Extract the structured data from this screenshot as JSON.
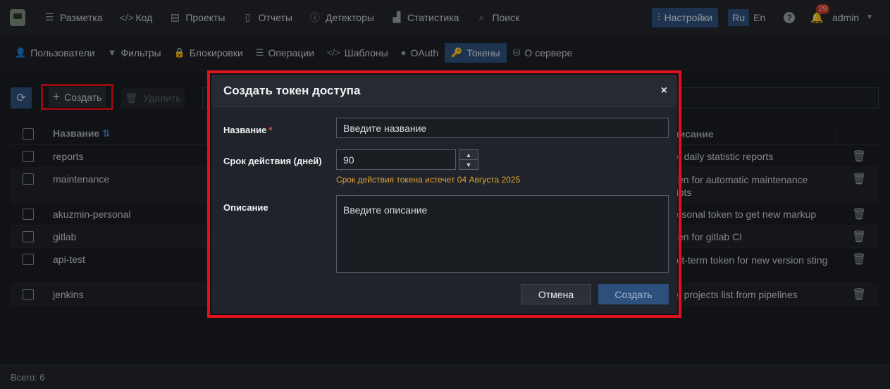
{
  "topnav": {
    "items": [
      {
        "label": "Разметка",
        "icon": "list-icon"
      },
      {
        "label": "Код",
        "icon": "code-icon"
      },
      {
        "label": "Проекты",
        "icon": "box-icon"
      },
      {
        "label": "Отчеты",
        "icon": "document-icon"
      },
      {
        "label": "Детекторы",
        "icon": "alert-circle-icon"
      },
      {
        "label": "Статистика",
        "icon": "chart-icon"
      },
      {
        "label": "Поиск",
        "icon": "search-icon"
      }
    ],
    "settings_label": "Настройки",
    "lang_ru": "Ru",
    "lang_en": "En",
    "notifications_count": "29",
    "user": "admin"
  },
  "subnav": {
    "items": [
      {
        "label": "Пользователи",
        "icon": "users-icon"
      },
      {
        "label": "Фильтры",
        "icon": "filter-icon"
      },
      {
        "label": "Блокировки",
        "icon": "lock-icon"
      },
      {
        "label": "Операции",
        "icon": "list-icon"
      },
      {
        "label": "Шаблоны",
        "icon": "code-icon"
      },
      {
        "label": "OAuth",
        "icon": "oauth-icon"
      },
      {
        "label": "Токены",
        "icon": "key-icon"
      },
      {
        "label": "О сервере",
        "icon": "database-icon"
      }
    ],
    "active": "Токены"
  },
  "toolbar": {
    "create_label": "Создать",
    "delete_label": "Удалить"
  },
  "table": {
    "col_name": "Название",
    "col_desc": "писание",
    "rows": [
      {
        "name": "reports",
        "desc": "et daily statistic reports"
      },
      {
        "name": "maintenance",
        "desc": "ken for automatic maintenance ripts"
      },
      {
        "name": "akuzmin-personal",
        "desc": "ersonal token to get new markup"
      },
      {
        "name": "gitlab",
        "desc": "ken for gitlab CI"
      },
      {
        "name": "api-test",
        "desc": "ort-term token for new version sting"
      },
      {
        "name": "jenkins",
        "desc": "et projects list from pipelines"
      }
    ]
  },
  "footer": {
    "total": "Всего: 6"
  },
  "modal": {
    "title": "Создать токен доступа",
    "close": "×",
    "name_label": "Название",
    "name_required": "*",
    "name_placeholder": "Введите название",
    "days_label": "Срок действия (дней)",
    "days_value": "90",
    "expire_note": "Срок действия токена истечет 04 Августа 2025",
    "desc_label": "Описание",
    "desc_placeholder": "Введите описание",
    "cancel_label": "Отмена",
    "submit_label": "Создать"
  },
  "colors": {
    "accent": "#2d4f7c",
    "highlight_border": "#e3101b",
    "warning_text": "#e0a13a"
  }
}
